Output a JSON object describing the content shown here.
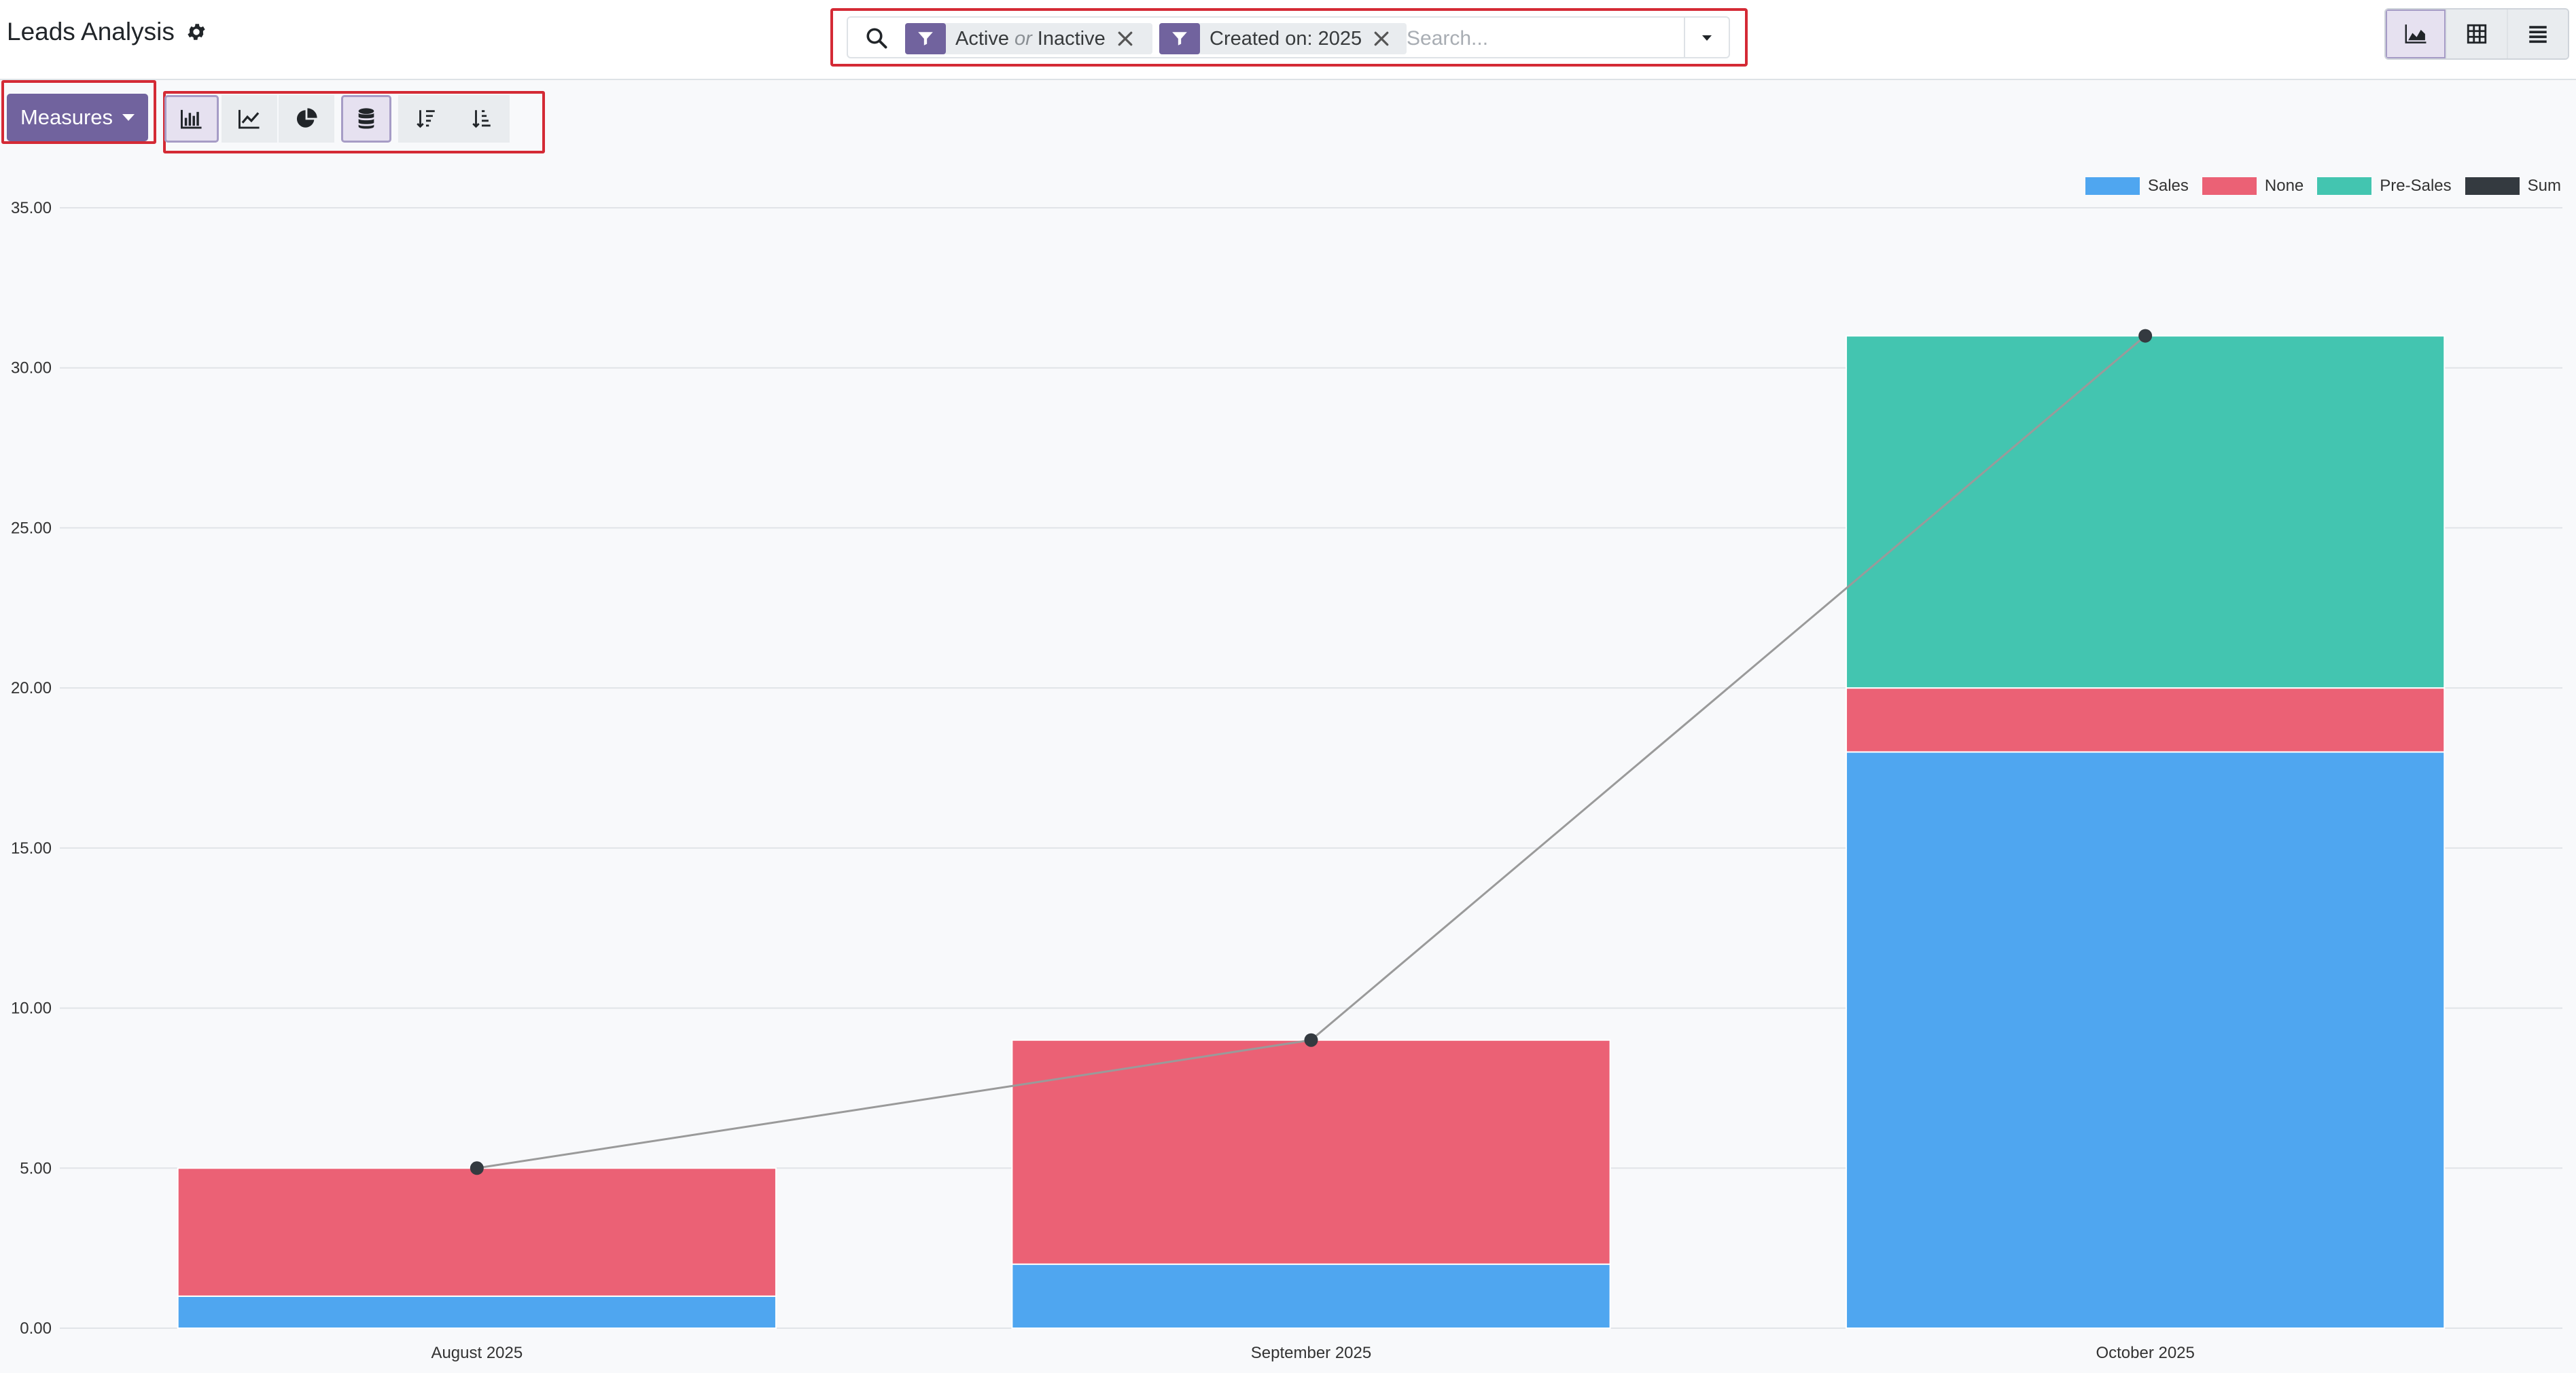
{
  "app": {
    "title": "Leads Analysis"
  },
  "search": {
    "facets": [
      {
        "type": "filter",
        "parts": [
          "Active",
          "or",
          "Inactive"
        ]
      },
      {
        "type": "filter",
        "label": "Created on: 2025"
      }
    ],
    "placeholder": "Search..."
  },
  "view_switcher": [
    "graph-icon",
    "pivot-icon",
    "list-icon"
  ],
  "toolbar": {
    "measures_label": "Measures",
    "chart_type_buttons": [
      "bar-chart-icon",
      "line-chart-icon",
      "pie-chart-icon"
    ],
    "stacked_button": "database-stack-icon",
    "sort_buttons": [
      "sort-descending-icon",
      "sort-ascending-icon"
    ]
  },
  "colors": {
    "Sales": "#4fa6f0",
    "None": "#eb6175",
    "Pre-Sales": "#43c5b0",
    "Sum": "#343a40",
    "accent": "#71639e",
    "highlight": "#d42a35"
  },
  "chart_data": {
    "type": "bar",
    "stacked": true,
    "categories": [
      "August 2025",
      "September 2025",
      "October 2025"
    ],
    "series": [
      {
        "name": "Sales",
        "values": [
          1,
          2,
          18
        ]
      },
      {
        "name": "None",
        "values": [
          4,
          7,
          2
        ]
      },
      {
        "name": "Pre-Sales",
        "values": [
          0,
          0,
          11
        ]
      }
    ],
    "sum_line": {
      "name": "Sum",
      "values": [
        5,
        9,
        31
      ]
    },
    "ylim": [
      0,
      35
    ],
    "yticks": [
      "0.00",
      "5.00",
      "10.00",
      "15.00",
      "20.00",
      "25.00",
      "30.00",
      "35.00"
    ],
    "legend": [
      "Sales",
      "None",
      "Pre-Sales",
      "Sum"
    ],
    "legend_position": "top-right",
    "grid": true
  }
}
